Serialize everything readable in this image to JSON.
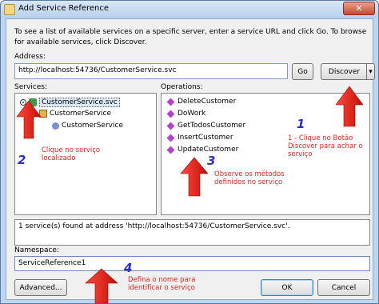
{
  "window": {
    "title": "Add Service Reference",
    "close_glyph": "✕"
  },
  "intro_text": "To see a list of available services on a specific server, enter a service URL and click Go. To browse for available services, click Discover.",
  "address": {
    "label": "Address:",
    "value": "http://localhost:54736/CustomerService.svc",
    "go_label": "Go",
    "discover_label": "Discover",
    "discover_arrow": "▾"
  },
  "services": {
    "label": "Services:",
    "tree": [
      {
        "label": "CustomerService.svc",
        "icon": "service-icon"
      },
      {
        "label": "CustomerService",
        "icon": "class-icon"
      },
      {
        "label": "CustomerService",
        "icon": "contract-icon"
      }
    ]
  },
  "operations": {
    "label": "Operations:",
    "items": [
      "DeleteCustomer",
      "DoWork",
      "GetTodosCustomer",
      "InsertCustomer",
      "UpdateCustomer"
    ]
  },
  "status": "1 service(s) found at address 'http://localhost:54736/CustomerService.svc'.",
  "namespace": {
    "label": "Namespace:",
    "value": "ServiceReference1"
  },
  "buttons": {
    "advanced": "Advanced...",
    "ok": "OK",
    "cancel": "Cancel"
  },
  "annotations": {
    "n1": "1",
    "n2": "2",
    "n3": "3",
    "n4": "4",
    "t1": "1 - Clique no Botão Discover para achar o serviço",
    "t2": "Clique no serviço localizado",
    "t3": "Observe os métodos definidos no serviço",
    "t4": "Defina o nome para identificar o serviço",
    "color_text": "#e0241b",
    "color_number": "#2b2fbf"
  }
}
